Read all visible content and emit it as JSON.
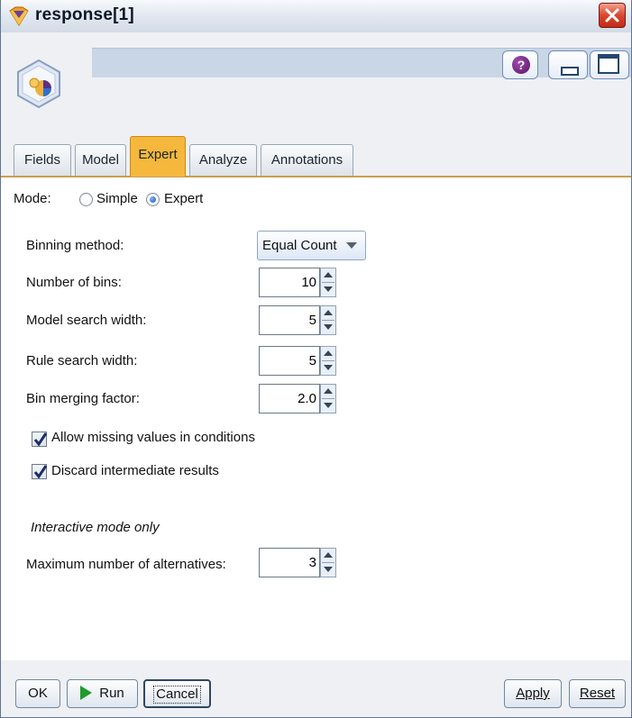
{
  "window": {
    "title": "response[1]"
  },
  "tabs": [
    {
      "label": "Fields"
    },
    {
      "label": "Model"
    },
    {
      "label": "Expert"
    },
    {
      "label": "Analyze"
    },
    {
      "label": "Annotations"
    }
  ],
  "active_tab": "Expert",
  "mode": {
    "label": "Mode:",
    "options": [
      "Simple",
      "Expert"
    ],
    "selected": "Expert"
  },
  "binning_method": {
    "label": "Binning method:",
    "value": "Equal Count"
  },
  "number_of_bins": {
    "label": "Number of bins:",
    "value": "10"
  },
  "model_search_width": {
    "label": "Model search width:",
    "value": "5"
  },
  "rule_search_width": {
    "label": "Rule search width:",
    "value": "5"
  },
  "bin_merging_factor": {
    "label": "Bin merging factor:",
    "value": "2.0"
  },
  "allow_missing": {
    "label": "Allow missing values in conditions",
    "checked": true
  },
  "discard_intermediate": {
    "label": "Discard intermediate results",
    "checked": true
  },
  "interactive_section": {
    "label": "Interactive mode only"
  },
  "max_alternatives": {
    "label": "Maximum number of alternatives:",
    "value": "3"
  },
  "footer": {
    "ok": "OK",
    "run": "Run",
    "cancel": "Cancel",
    "apply": "Apply",
    "reset": "Reset"
  },
  "icons": [
    "node-gem-icon",
    "help-icon",
    "minimize-icon",
    "maximize-icon",
    "close-icon",
    "run-play-icon"
  ],
  "colors": {
    "active_tab": "#f5b83d",
    "close_button": "#d9482f",
    "header_bar": "#c9d6e6"
  }
}
